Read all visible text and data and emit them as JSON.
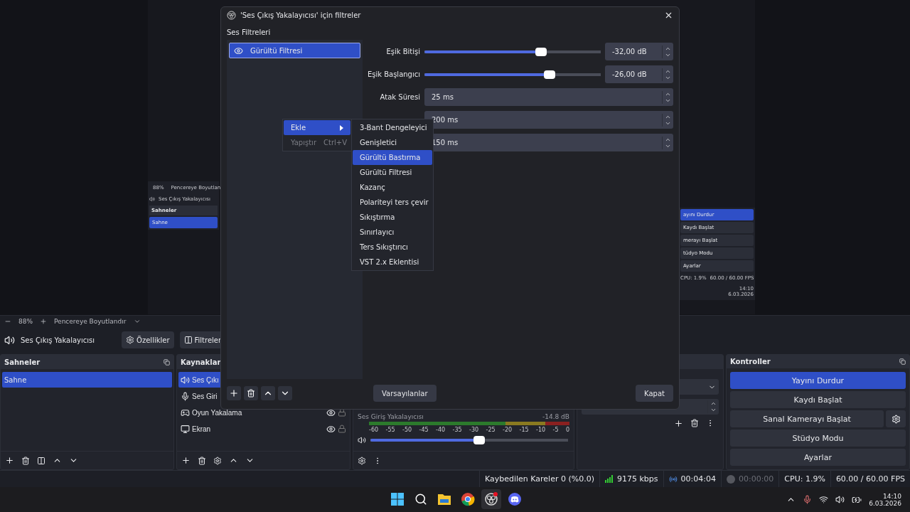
{
  "preview": {
    "nested_left": {
      "zoom": "88%",
      "fit": "Pencereye Boyutlan",
      "source": "Ses Çıkış Yakalayıcısı",
      "scenes_title": "Sahneler",
      "scene": "Sahne"
    },
    "nested_right": {
      "buttons": [
        {
          "label": "ayını Durdur",
          "active": true
        },
        {
          "label": "Kaydı Başlat",
          "active": false
        },
        {
          "label": "merayı Başlat",
          "active": false
        },
        {
          "label": "tüdyo Modu",
          "active": false
        },
        {
          "label": "Ayarlar",
          "active": false
        }
      ],
      "cpu": "CPU: 1.9%",
      "fps": "60.00 / 60.00 FPS",
      "time": "14:10",
      "date": "6.03.2026"
    }
  },
  "preview_toolbar": {
    "zoom": "88%",
    "fit": "Pencereye Boyutlandır"
  },
  "source_bar": {
    "name": "Ses Çıkış Yakalayıcısı",
    "buttons": [
      "Özellikler",
      "Filtreler"
    ]
  },
  "scenes": {
    "title": "Sahneler",
    "items": [
      {
        "label": "Sahne",
        "selected": true
      }
    ]
  },
  "sources": {
    "title": "Kaynaklar",
    "items": [
      {
        "label": "Ses Çıkı",
        "kind": "speaker",
        "selected": true
      },
      {
        "label": "Ses Giri",
        "kind": "mic",
        "selected": false
      },
      {
        "label": "Oyun Yakalama",
        "kind": "game",
        "selected": false
      },
      {
        "label": "Ekran",
        "kind": "monitor",
        "selected": false
      }
    ]
  },
  "mixer": {
    "channel": "Ses Giriş Yakalayıcısı",
    "reading": "-14.8 dB",
    "scale": [
      "-60",
      "-55",
      "-50",
      "-45",
      "-40",
      "-35",
      "-30",
      "-25",
      "-20",
      "-15",
      "-10",
      "-5",
      "0"
    ],
    "level": 0.55
  },
  "controls": {
    "title": "Kontroller",
    "buttons": [
      {
        "label": "Yayını Durdur",
        "active": true,
        "gear": false
      },
      {
        "label": "Kaydı Başlat",
        "active": false,
        "gear": false
      },
      {
        "label": "Sanal Kamerayı Başlat",
        "active": false,
        "gear": true
      },
      {
        "label": "Stüdyo Modu",
        "active": false,
        "gear": false
      },
      {
        "label": "Ayarlar",
        "active": false,
        "gear": false
      }
    ]
  },
  "status_bar": {
    "dropped": "Kaybedilen Kareler 0 (%0.0)",
    "bitrate": "9175 kbps",
    "stream_time": "00:04:04",
    "record_time": "00:00:00",
    "cpu": "CPU: 1.9%",
    "fps": "60.00 / 60.00 FPS"
  },
  "taskbar": {
    "apps": [
      {
        "kind": "windows",
        "active": false
      },
      {
        "kind": "search",
        "active": false
      },
      {
        "kind": "folder",
        "active": false
      },
      {
        "kind": "chrome",
        "active": false
      },
      {
        "kind": "obs",
        "active": true
      },
      {
        "kind": "discord",
        "active": false
      }
    ],
    "time": "14:10",
    "date": "6.03.2026"
  },
  "dialog": {
    "title": "'Ses Çıkış Yakalayıcısı' için filtreler",
    "section": "Ses Filtreleri",
    "filters": [
      {
        "label": "Gürültü Filtresi",
        "selected": true
      }
    ],
    "fields": [
      {
        "kind": "slider",
        "label": "Eşik Bitişi",
        "level": 0.66,
        "value": "-32,00 dB"
      },
      {
        "kind": "slider",
        "label": "Eşik Başlangıcı",
        "level": 0.71,
        "value": "-26,00 dB"
      },
      {
        "kind": "spin",
        "label": "Atak Süresi",
        "value": "25 ms"
      },
      {
        "kind": "spin",
        "value": "200 ms"
      },
      {
        "kind": "spin",
        "value": "150 ms"
      }
    ],
    "buttons": [
      "Varsayılanlar",
      "Kapat"
    ]
  },
  "context_menu": {
    "items": [
      {
        "label": "Ekle",
        "selected": true,
        "disabled": false
      },
      {
        "label": "Yapıştır",
        "shortcut": "Ctrl+V",
        "selected": false,
        "disabled": true
      }
    ],
    "submenu": [
      {
        "label": "3-Bant Dengeleyici",
        "selected": false
      },
      {
        "label": "Genişletici",
        "selected": false
      },
      {
        "label": "Gürültü Bastırma",
        "selected": true
      },
      {
        "label": "Gürültü Filtresi",
        "selected": false
      },
      {
        "label": "Kazanç",
        "selected": false
      },
      {
        "label": "Polariteyi ters çevir",
        "selected": false
      },
      {
        "label": "Sıkıştırma",
        "selected": false
      },
      {
        "label": "Sınırlayıcı",
        "selected": false
      },
      {
        "label": "Ters Sıkıştırıcı",
        "selected": false
      },
      {
        "label": "VST 2.x Eklentisi",
        "selected": false
      }
    ]
  }
}
